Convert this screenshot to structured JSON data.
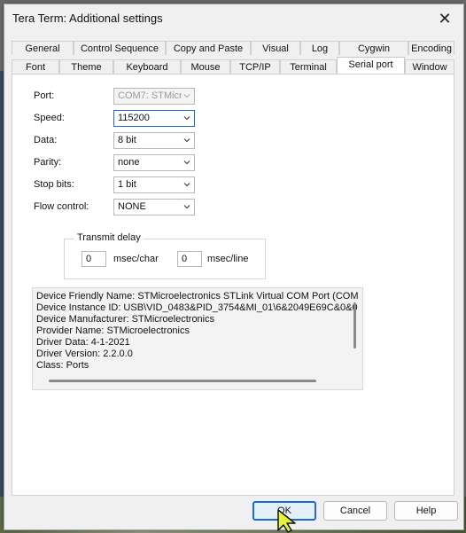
{
  "window": {
    "title": "Tera Term: Additional settings"
  },
  "tabs_row1": [
    "General",
    "Control Sequence",
    "Copy and Paste",
    "Visual",
    "Log",
    "Cygwin",
    "Encoding"
  ],
  "tabs_row2": [
    "Font",
    "Theme",
    "Keyboard",
    "Mouse",
    "TCP/IP",
    "Terminal",
    "Serial port",
    "Window"
  ],
  "active_tab": "Serial port",
  "form": {
    "port_label": "Port:",
    "port_value": "COM7: STMicr",
    "speed_label": "Speed:",
    "speed_value": "115200",
    "data_label": "Data:",
    "data_value": "8 bit",
    "parity_label": "Parity:",
    "parity_value": "none",
    "stop_label": "Stop bits:",
    "stop_value": "1 bit",
    "flow_label": "Flow control:",
    "flow_value": "NONE"
  },
  "transmit_delay": {
    "title": "Transmit delay",
    "char_value": "0",
    "char_unit": "msec/char",
    "line_value": "0",
    "line_unit": "msec/line"
  },
  "device_info": [
    "Device Friendly Name: STMicroelectronics STLink Virtual COM Port (COM",
    "Device Instance ID: USB\\VID_0483&PID_3754&MI_01\\6&2049E69C&0&0",
    "Device Manufacturer: STMicroelectronics",
    "Provider Name: STMicroelectronics",
    "Driver Data: 4-1-2021",
    "Driver Version: 2.2.0.0",
    "Class: Ports"
  ],
  "buttons": {
    "ok": "OK",
    "cancel": "Cancel",
    "help": "Help"
  },
  "icons": {
    "close": "close-icon",
    "chevron": "chevron-down-icon",
    "cursor": "mouse-pointer-icon"
  },
  "colors": {
    "accent": "#1b6ad2",
    "cursor_fill": "#e6f33a"
  }
}
